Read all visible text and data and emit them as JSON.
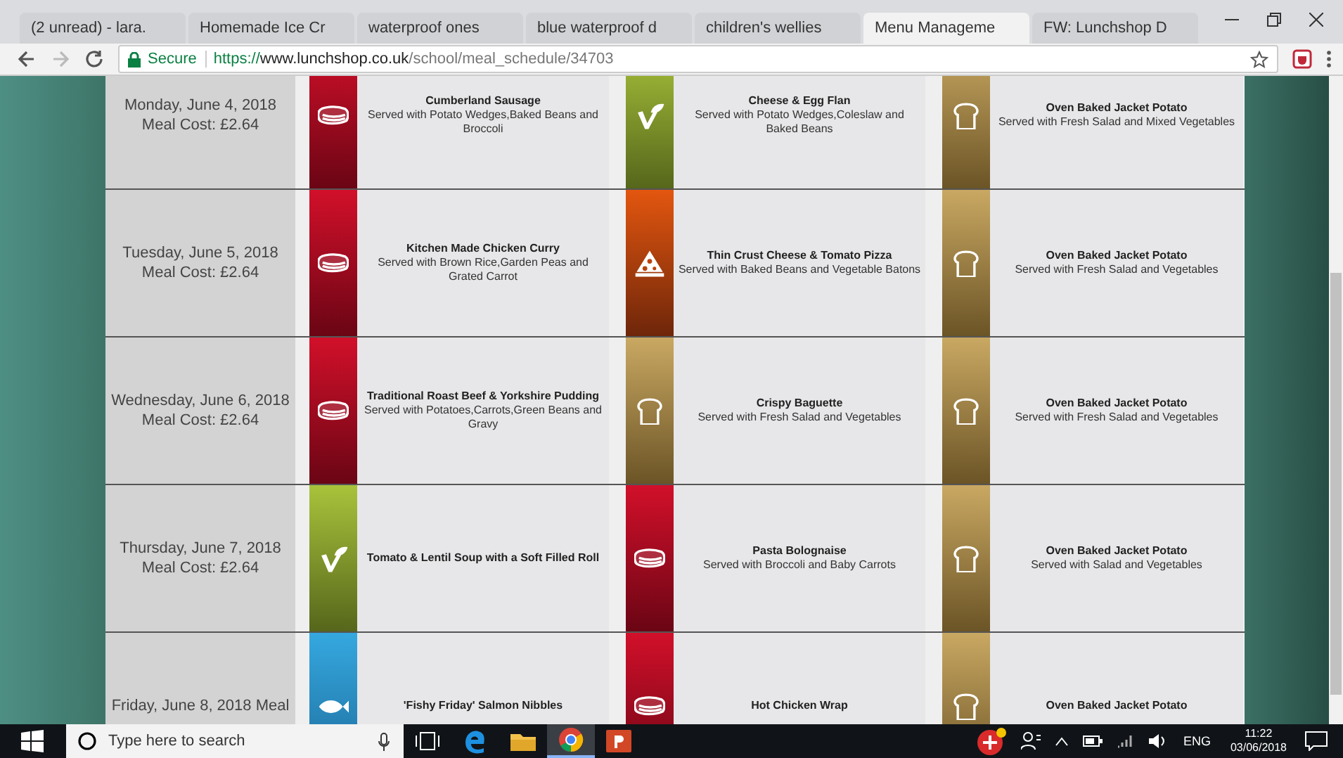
{
  "tabs": [
    {
      "label": "(2 unread) - lara.",
      "selected": false
    },
    {
      "label": "Homemade Ice Cr",
      "selected": false
    },
    {
      "label": "waterproof ones",
      "selected": false
    },
    {
      "label": "blue waterproof d",
      "selected": false
    },
    {
      "label": "children's wellies",
      "selected": false
    },
    {
      "label": "Menu Manageme",
      "selected": true
    },
    {
      "label": "FW: Lunchshop D",
      "selected": false
    }
  ],
  "address_bar": {
    "secure_label": "Secure",
    "url_scheme": "https://",
    "url_host": "www.lunchshop.co.uk",
    "url_path": "/school/meal_schedule/34703"
  },
  "rows": [
    {
      "date": "Monday, June 4, 2018",
      "cost": "Meal Cost: £2.64",
      "meals": [
        {
          "kind": "meat",
          "name": "Cumberland Sausage",
          "detail": "Served with Potato Wedges,Baked Beans and Broccoli"
        },
        {
          "kind": "veg",
          "name": "Cheese & Egg Flan",
          "detail": "Served with Potato Wedges,Coleslaw and Baked Beans"
        },
        {
          "kind": "bread",
          "name": "Oven Baked Jacket Potato",
          "detail": "Served with Fresh Salad and Mixed Vegetables"
        }
      ]
    },
    {
      "date": "Tuesday, June 5, 2018",
      "cost": "Meal Cost: £2.64",
      "meals": [
        {
          "kind": "meat",
          "name": "Kitchen Made Chicken Curry",
          "detail": "Served with Brown Rice,Garden Peas and Grated Carrot"
        },
        {
          "kind": "pizza",
          "name": "Thin Crust Cheese & Tomato Pizza",
          "detail": "Served with Baked Beans and Vegetable Batons"
        },
        {
          "kind": "bread",
          "name": "Oven Baked Jacket Potato",
          "detail": "Served with Fresh Salad and Vegetables"
        }
      ]
    },
    {
      "date": "Wednesday, June 6, 2018",
      "cost": "Meal Cost: £2.64",
      "meals": [
        {
          "kind": "meat",
          "name": "Traditional Roast Beef & Yorkshire Pudding",
          "detail": "Served with Potatoes,Carrots,Green Beans and Gravy"
        },
        {
          "kind": "bread",
          "name": "Crispy Baguette",
          "detail": "Served with Fresh Salad and Vegetables"
        },
        {
          "kind": "bread",
          "name": "Oven Baked Jacket Potato",
          "detail": "Served with Fresh Salad and Vegetables"
        }
      ]
    },
    {
      "date": "Thursday, June 7, 2018",
      "cost": "Meal Cost: £2.64",
      "meals": [
        {
          "kind": "veg",
          "name": "Tomato & Lentil Soup with a Soft Filled Roll"
        },
        {
          "kind": "meat",
          "name": "Pasta Bolognaise",
          "detail": "Served with Broccoli and Baby Carrots"
        },
        {
          "kind": "bread",
          "name": "Oven Baked Jacket Potato",
          "detail": "Served with Salad and Vegetables"
        }
      ]
    },
    {
      "date": "Friday, June 8, 2018 Meal",
      "meals": [
        {
          "kind": "fish",
          "name": "'Fishy Friday' Salmon Nibbles"
        },
        {
          "kind": "meat",
          "name": "Hot Chicken Wrap"
        },
        {
          "kind": "bread",
          "name": "Oven Baked Jacket Potato"
        }
      ]
    }
  ],
  "taskbar": {
    "search_placeholder": "Type here to search",
    "apps": [
      {
        "kind": "taskview",
        "selected": false
      },
      {
        "kind": "edge",
        "selected": false
      },
      {
        "kind": "folder",
        "selected": false
      },
      {
        "kind": "chrome",
        "selected": true
      },
      {
        "kind": "powerpoint",
        "selected": false
      }
    ],
    "language": "ENG",
    "time": "11:22",
    "date": "03/06/2018"
  }
}
